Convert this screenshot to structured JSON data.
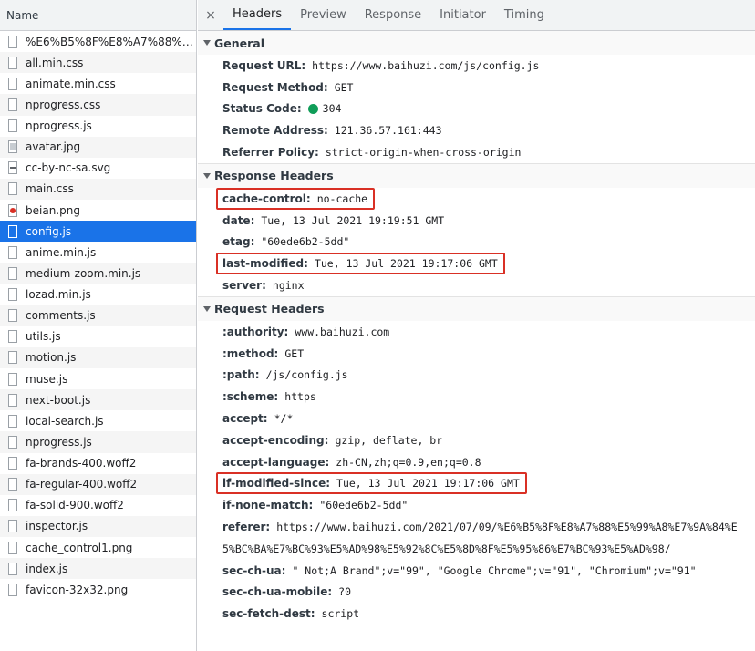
{
  "list_header": "Name",
  "requests": [
    {
      "name": "%E6%B5%8F%E8%A7%88%E...",
      "icon": "file-icon"
    },
    {
      "name": "all.min.css",
      "icon": "file-icon"
    },
    {
      "name": "animate.min.css",
      "icon": "file-icon"
    },
    {
      "name": "nprogress.css",
      "icon": "file-icon"
    },
    {
      "name": "nprogress.js",
      "icon": "file-icon"
    },
    {
      "name": "avatar.jpg",
      "icon": "image-file-icon"
    },
    {
      "name": "cc-by-nc-sa.svg",
      "icon": "svg-file-icon"
    },
    {
      "name": "main.css",
      "icon": "file-icon"
    },
    {
      "name": "beian.png",
      "icon": "png-file-icon"
    },
    {
      "name": "config.js",
      "icon": "file-icon",
      "selected": true
    },
    {
      "name": "anime.min.js",
      "icon": "file-icon"
    },
    {
      "name": "medium-zoom.min.js",
      "icon": "file-icon"
    },
    {
      "name": "lozad.min.js",
      "icon": "file-icon"
    },
    {
      "name": "comments.js",
      "icon": "file-icon"
    },
    {
      "name": "utils.js",
      "icon": "file-icon"
    },
    {
      "name": "motion.js",
      "icon": "file-icon"
    },
    {
      "name": "muse.js",
      "icon": "file-icon"
    },
    {
      "name": "next-boot.js",
      "icon": "file-icon"
    },
    {
      "name": "local-search.js",
      "icon": "file-icon"
    },
    {
      "name": "nprogress.js",
      "icon": "file-icon"
    },
    {
      "name": "fa-brands-400.woff2",
      "icon": "file-icon"
    },
    {
      "name": "fa-regular-400.woff2",
      "icon": "file-icon"
    },
    {
      "name": "fa-solid-900.woff2",
      "icon": "file-icon"
    },
    {
      "name": "inspector.js",
      "icon": "file-icon"
    },
    {
      "name": "cache_control1.png",
      "icon": "file-icon"
    },
    {
      "name": "index.js",
      "icon": "file-icon"
    },
    {
      "name": "favicon-32x32.png",
      "icon": "file-icon"
    }
  ],
  "tabs": {
    "close": "×",
    "items": [
      "Headers",
      "Preview",
      "Response",
      "Initiator",
      "Timing"
    ],
    "active": "Headers"
  },
  "general": {
    "title": "General",
    "rows": [
      {
        "key": "Request URL:",
        "value": "https://www.baihuzi.com/js/config.js"
      },
      {
        "key": "Request Method:",
        "value": "GET"
      },
      {
        "key": "Status Code:",
        "value": "304",
        "status_color": "#0f9d58"
      },
      {
        "key": "Remote Address:",
        "value": "121.36.57.161:443"
      },
      {
        "key": "Referrer Policy:",
        "value": "strict-origin-when-cross-origin"
      }
    ]
  },
  "response_headers": {
    "title": "Response Headers",
    "rows": [
      {
        "key": "cache-control:",
        "value": "no-cache",
        "highlight": true
      },
      {
        "key": "date:",
        "value": "Tue, 13 Jul 2021 19:19:51 GMT"
      },
      {
        "key": "etag:",
        "value": "\"60ede6b2-5dd\""
      },
      {
        "key": "last-modified:",
        "value": "Tue, 13 Jul 2021 19:17:06 GMT",
        "highlight": true
      },
      {
        "key": "server:",
        "value": "nginx"
      }
    ]
  },
  "request_headers": {
    "title": "Request Headers",
    "rows": [
      {
        "key": ":authority:",
        "value": "www.baihuzi.com"
      },
      {
        "key": ":method:",
        "value": "GET"
      },
      {
        "key": ":path:",
        "value": "/js/config.js"
      },
      {
        "key": ":scheme:",
        "value": "https"
      },
      {
        "key": "accept:",
        "value": "*/*"
      },
      {
        "key": "accept-encoding:",
        "value": "gzip, deflate, br"
      },
      {
        "key": "accept-language:",
        "value": "zh-CN,zh;q=0.9,en;q=0.8"
      },
      {
        "key": "if-modified-since:",
        "value": "Tue, 13 Jul 2021 19:17:06 GMT",
        "highlight": true
      },
      {
        "key": "if-none-match:",
        "value": "\"60ede6b2-5dd\""
      },
      {
        "key": "referer:",
        "value": "https://www.baihuzi.com/2021/07/09/%E6%B5%8F%E8%A7%88%E5%99%A8%E7%9A%84%E",
        "cont": "5%BC%BA%E7%BC%93%E5%AD%98%E5%92%8C%E5%8D%8F%E5%95%86%E7%BC%93%E5%AD%98/"
      },
      {
        "key": "sec-ch-ua:",
        "value": "\" Not;A Brand\";v=\"99\", \"Google Chrome\";v=\"91\", \"Chromium\";v=\"91\""
      },
      {
        "key": "sec-ch-ua-mobile:",
        "value": "?0"
      },
      {
        "key": "sec-fetch-dest:",
        "value": "script"
      }
    ]
  },
  "colors": {
    "selection": "#1a73e8",
    "highlight_box": "#d93025",
    "status_ok": "#0f9d58"
  }
}
